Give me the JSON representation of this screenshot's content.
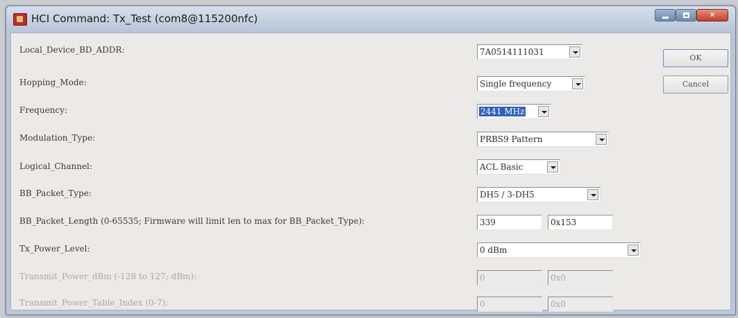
{
  "window": {
    "title": "HCI Command: Tx_Test (com8@115200nfc)"
  },
  "form": {
    "local_device": {
      "label": "Local_Device_BD_ADDR:",
      "value": "7A0514111031"
    },
    "hopping_mode": {
      "label": "Hopping_Mode:",
      "value": "Single frequency"
    },
    "frequency": {
      "label": "Frequency:",
      "value": "2441 MHz"
    },
    "modulation_type": {
      "label": "Modulation_Type:",
      "value": "PRBS9 Pattern"
    },
    "logical_channel": {
      "label": "Logical_Channel:",
      "value": "ACL Basic"
    },
    "bb_packet_type": {
      "label": "BB_Packet_Type:",
      "value": "DH5 / 3-DH5"
    },
    "bb_packet_length": {
      "label": "BB_Packet_Length (0-65535; Firmware will limit len to max for BB_Packet_Type):",
      "value_dec": "339",
      "value_hex": "0x153"
    },
    "tx_power_level": {
      "label": "Tx_Power_Level:",
      "value": "0 dBm"
    },
    "transmit_power_dbm": {
      "label": "Transmit_Power_dBm (-128 to 127; dBm):",
      "value_dec": "0",
      "value_hex": "0x0"
    },
    "transmit_power_table_index": {
      "label": "Transmit_Power_Table_Index (0-7):",
      "value_dec": "0",
      "value_hex": "0x0"
    }
  },
  "buttons": {
    "ok": "OK",
    "cancel": "Cancel"
  }
}
